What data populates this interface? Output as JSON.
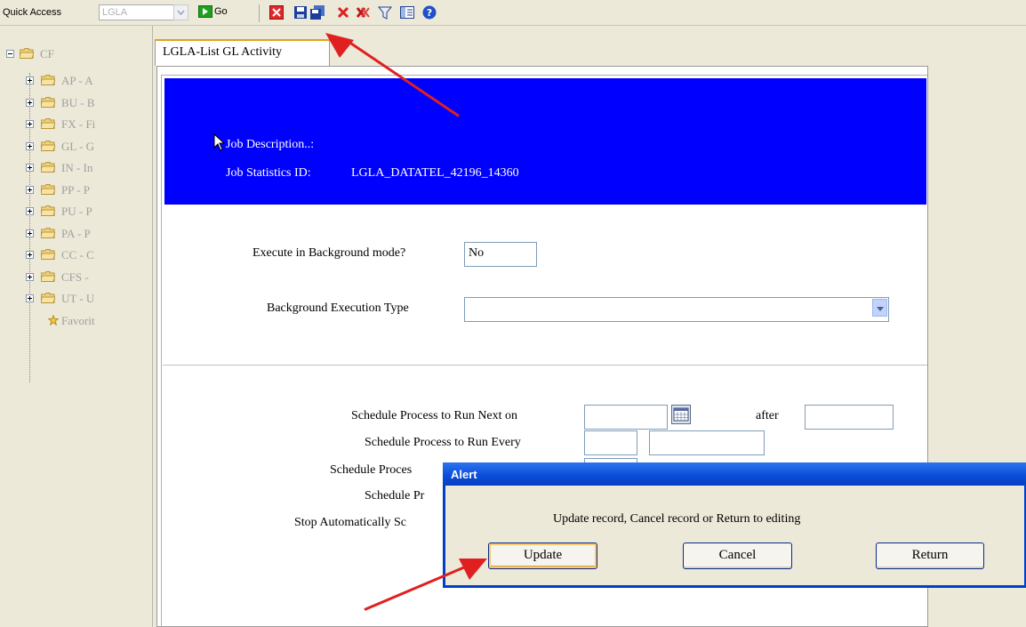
{
  "toolbar": {
    "quick_access_label": "Quick Access",
    "quick_access_value": "LGLA",
    "go_label": "Go"
  },
  "tree": {
    "root": "CF",
    "items": [
      "AP - A",
      "BU - B",
      "FX - Fi",
      "GL - G",
      "IN - In",
      "PP - P",
      "PU - P",
      "PA - P",
      "CC - C",
      "CFS - ",
      "UT - U"
    ],
    "favorites": "Favorit"
  },
  "tab": {
    "label": "LGLA-List GL Activity"
  },
  "job": {
    "description_label": "Job Description..:",
    "stats_label": "Job Statistics ID:",
    "stats_value": "LGLA_DATATEL_42196_14360"
  },
  "form": {
    "background_mode_label": "Execute in Background mode?",
    "background_mode_value": "No",
    "background_type_label": "Background Execution Type",
    "background_type_value": "",
    "run_next_label": "Schedule Process to Run Next on",
    "after_label": "after",
    "run_every_label": "Schedule Process to Run Every",
    "row3_label": "Schedule Proces",
    "row4_label": "Schedule Pr",
    "stop_label": "Stop Automatically Sc"
  },
  "alert": {
    "title": "Alert",
    "message": "Update record, Cancel record or Return to editing",
    "update_label": "Update",
    "cancel_label": "Cancel",
    "return_label": "Return"
  },
  "colors": {
    "header_blue": "#0000ff",
    "dialog_title": "#0a4bd8",
    "annotation_arrow": "#e02020"
  }
}
